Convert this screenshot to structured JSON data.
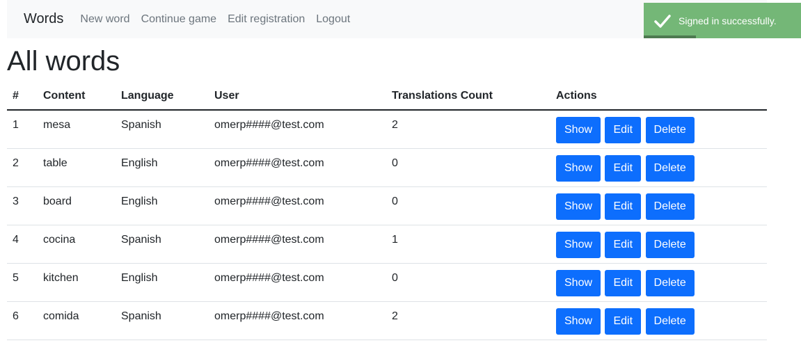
{
  "navbar": {
    "brand": "Words",
    "links": [
      "New word",
      "Continue game",
      "Edit registration",
      "Logout"
    ]
  },
  "page_title": "All words",
  "table": {
    "headers": [
      "#",
      "Content",
      "Language",
      "User",
      "Translations Count",
      "Actions"
    ],
    "rows": [
      {
        "id": "1",
        "content": "mesa",
        "language": "Spanish",
        "user": "omerp####@test.com",
        "count": "2"
      },
      {
        "id": "2",
        "content": "table",
        "language": "English",
        "user": "omerp####@test.com",
        "count": "0"
      },
      {
        "id": "3",
        "content": "board",
        "language": "English",
        "user": "omerp####@test.com",
        "count": "0"
      },
      {
        "id": "4",
        "content": "cocina",
        "language": "Spanish",
        "user": "omerp####@test.com",
        "count": "1"
      },
      {
        "id": "5",
        "content": "kitchen",
        "language": "English",
        "user": "omerp####@test.com",
        "count": "0"
      },
      {
        "id": "6",
        "content": "comida",
        "language": "Spanish",
        "user": "omerp####@test.com",
        "count": "2"
      }
    ],
    "actions": {
      "show": "Show",
      "edit": "Edit",
      "delete": "Delete"
    }
  },
  "toast": {
    "message": "Signed in successfully.",
    "icon": "check-icon",
    "progress": 0.33
  },
  "colors": {
    "primary_button": "#0d6efd",
    "toast_background": "#74b777",
    "navbar_background": "#f8f9fa"
  }
}
